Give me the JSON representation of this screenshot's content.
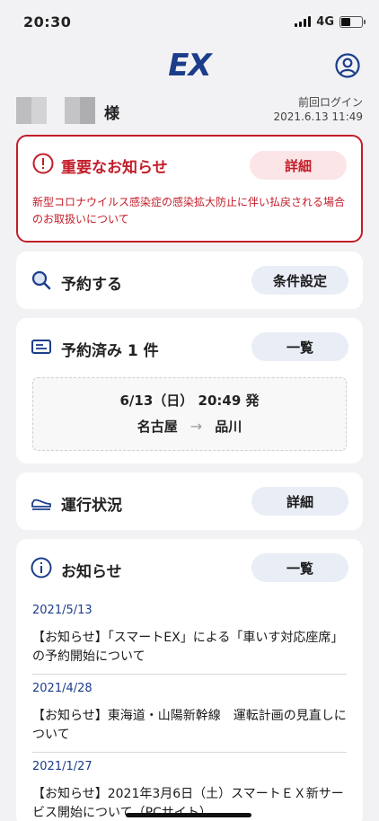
{
  "status_bar": {
    "time": "20:30",
    "network": "4G"
  },
  "header": {
    "logo_text": "EX"
  },
  "user": {
    "honorific": "様",
    "last_login_label": "前回ログイン",
    "last_login_time": "2021.6.13 11:49"
  },
  "alert": {
    "title": "重要なお知らせ",
    "button_label": "詳細",
    "body": "新型コロナウイルス感染症の感染拡大防止に伴い払戻される場合のお取扱いについて"
  },
  "reserve": {
    "title": "予約する",
    "button_label": "条件設定"
  },
  "booked": {
    "title": "予約済み 1 件",
    "button_label": "一覧",
    "trip_date": "6/13（日） 20:49 発",
    "from": "名古屋",
    "to": "品川",
    "arrow": "→"
  },
  "operation": {
    "title": "運行状況",
    "button_label": "詳細"
  },
  "news": {
    "title": "お知らせ",
    "button_label": "一覧",
    "items": [
      {
        "date": "2021/5/13",
        "text": "【お知らせ】「スマートEX」による「車いす対応座席」の予約開始について"
      },
      {
        "date": "2021/4/28",
        "text": "【お知らせ】東海道・山陽新幹線　運転計画の見直しについて"
      },
      {
        "date": "2021/1/27",
        "text": "【お知らせ】2021年3月6日（土）スマートＥＸ新サービス開始について（PCサイト）"
      }
    ]
  },
  "colors": {
    "brand_blue": "#1b3d8a",
    "alert_red": "#c21d2a",
    "pill_bg": "#e9edf5"
  }
}
